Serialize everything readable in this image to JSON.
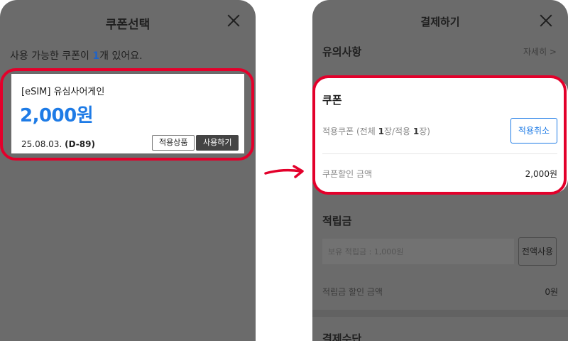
{
  "coupon_modal": {
    "title": "쿠폰선택",
    "available_prefix": "사용 가능한 쿠폰이 ",
    "available_count": "1",
    "available_suffix": "개 있어요.",
    "coupon": {
      "name": "[eSIM] 유심사어게인",
      "amount": "2,000원",
      "date": "25.08.03.",
      "dday": "(D-89)",
      "applicable_label": "적용상품",
      "use_label": "사용하기"
    }
  },
  "checkout": {
    "title": "결제하기",
    "notice_label": "유의사항",
    "notice_more": "자세히 >",
    "coupon_section": {
      "title": "쿠폰",
      "applied_prefix": "적용쿠폰 (전체 ",
      "applied_total": "1",
      "applied_middle": "장/적용 ",
      "applied_count": "1",
      "applied_suffix": "장)",
      "cancel_label": "적용취소",
      "discount_label": "쿠폰할인 금액",
      "discount_value": "2,000원"
    },
    "points": {
      "title": "적립금",
      "input_placeholder": "보유 적립금 : 1,000원",
      "use_all_label": "전액사용",
      "discount_label": "적립금 할인 금액",
      "discount_value": "0원"
    },
    "payment_method_label": "결제수단"
  },
  "colors": {
    "highlight": "#e3002b",
    "accent": "#1e7be6",
    "overlay": "#6b6b6b"
  },
  "icons": [
    "close-icon",
    "arrow-right-icon"
  ]
}
